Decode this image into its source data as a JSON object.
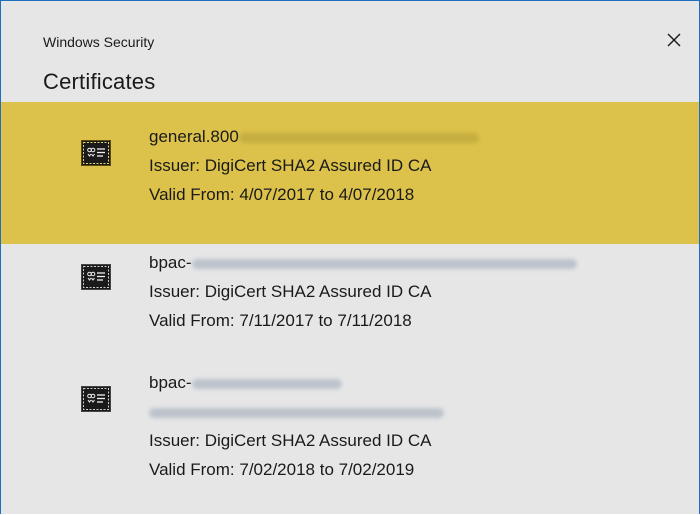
{
  "window": {
    "app_title": "Windows Security",
    "heading": "Certificates"
  },
  "certificates": [
    {
      "name_prefix": "general.800",
      "issuer": "Issuer: DigiCert SHA2 Assured ID CA",
      "valid": "Valid From: 4/07/2017 to 4/07/2018",
      "selected": true
    },
    {
      "name_prefix": "bpac-",
      "issuer": "Issuer: DigiCert SHA2 Assured ID CA",
      "valid": "Valid From: 7/11/2017 to 7/11/2018",
      "selected": false
    },
    {
      "name_prefix": "bpac-",
      "issuer": "Issuer: DigiCert SHA2 Assured ID CA",
      "valid": "Valid From: 7/02/2018 to 7/02/2019",
      "selected": false
    }
  ],
  "icons": {
    "close": "close-icon",
    "certificate": "certificate-icon"
  },
  "colors": {
    "selection": "#dcc24a",
    "background": "#e6e6e6",
    "border": "#1f6fbf"
  }
}
